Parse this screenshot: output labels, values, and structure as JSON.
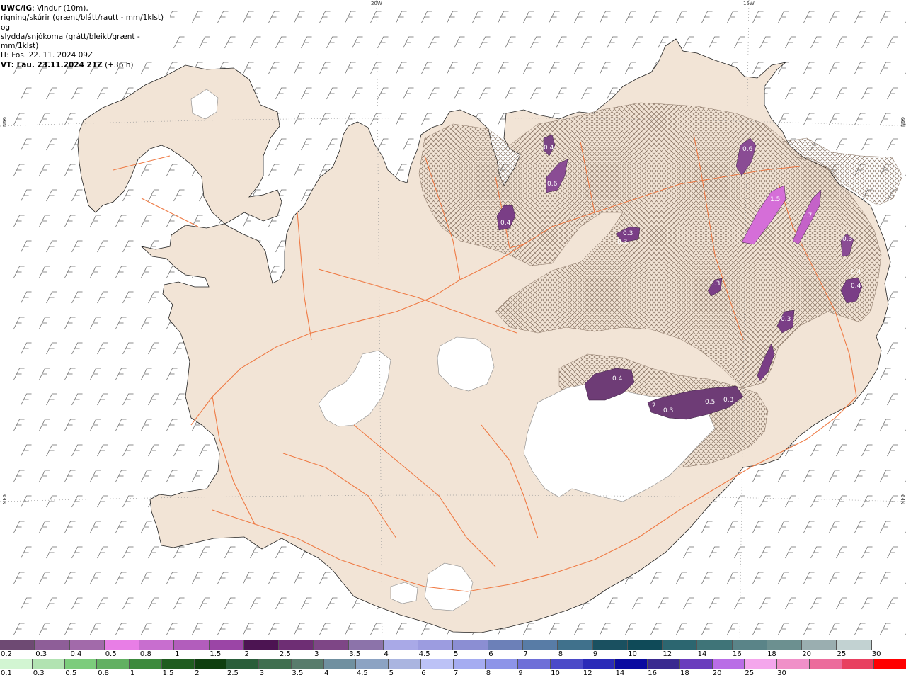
{
  "header": {
    "model": "UWC/IG",
    "desc1": ": Vindur (10m),",
    "desc2": "rigning/skúrir (grænt/blátt/rautt - mm/1klst) og",
    "desc3": "slydda/snjókoma (grátt/bleikt/grænt - mm/1klst)",
    "it_line": "IT: Fös. 22. 11. 2024 09Z",
    "vt_label": "VT: Lau. 23.11.2024 21Z",
    "vt_lead": " (+36 h)"
  },
  "grid_labels": {
    "lon_20w": "20W",
    "lon_15w": "15W",
    "lat_66_left": "66N",
    "lat_66_right": "66N",
    "lat_64_left": "64N",
    "lat_64_right": "64N"
  },
  "precip_values": {
    "p1": "0.4",
    "p2": "0.6",
    "p3": "0.4",
    "p4": "0.6",
    "p5": "0.3",
    "p6": "0.3",
    "p7": "1.5",
    "p8": "0.7",
    "p9": "0.3",
    "p10": "0.4",
    "p11": "0.4",
    "p12": "0.3",
    "p13": "0.4",
    "p14": "0.5",
    "p15": "0.3",
    "p16": "0.3",
    "p17": "2",
    "p18": "0.3"
  },
  "snow_scale": {
    "colors": [
      "#6e4a73",
      "#8e5e98",
      "#a26aaa",
      "#e87ee6",
      "#c86ecf",
      "#b25dbc",
      "#9b45a6",
      "#4c1452",
      "#6e2e74",
      "#7e4686",
      "#8c73aa",
      "#a9a9e7",
      "#9c9ce0",
      "#8b8ed3",
      "#6c80b8",
      "#587ca6",
      "#40718c",
      "#1a5060",
      "#0f4a58",
      "#2c6670",
      "#3f7478",
      "#5a8488",
      "#6c9090",
      "#9aaeb0",
      "#c2d2d2",
      "#ffffff"
    ],
    "labels": [
      "0.2",
      "0.3",
      "0.4",
      "0.5",
      "0.8",
      "1",
      "1.5",
      "2",
      "2.5",
      "3",
      "3.5",
      "4",
      "4.5",
      "5",
      "6",
      "7",
      "8",
      "9",
      "10",
      "12",
      "14",
      "16",
      "18",
      "20",
      "25",
      "30"
    ]
  },
  "rain_scale": {
    "colors": [
      "#d2f5d2",
      "#b2e3b2",
      "#7ccc7c",
      "#62b062",
      "#3c8a3c",
      "#1f5c1f",
      "#0f3f0f",
      "#2a5e3a",
      "#3f6f4f",
      "#587c6c",
      "#7090a0",
      "#8ca3c3",
      "#aab5e0",
      "#bcc2f6",
      "#a5acf1",
      "#8d94e8",
      "#6e6fd8",
      "#4b4ac8",
      "#2a2ab8",
      "#0a0aa0",
      "#3a2a90",
      "#6a3cbd",
      "#b96de6",
      "#f4a6ec",
      "#f090c8",
      "#ec6c9c",
      "#e84060",
      "#ff0000"
    ],
    "labels": [
      "0.1",
      "0.3",
      "0.5",
      "0.8",
      "1",
      "1.5",
      "2",
      "2.5",
      "3",
      "3.5",
      "4",
      "4.5",
      "5",
      "6",
      "7",
      "8",
      "9",
      "10",
      "12",
      "14",
      "16",
      "18",
      "20",
      "25",
      "30"
    ]
  }
}
